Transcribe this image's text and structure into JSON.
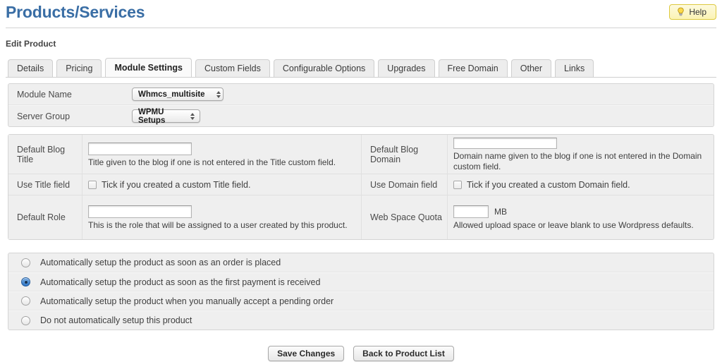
{
  "header": {
    "title": "Products/Services",
    "help_label": "Help",
    "help_icon": "lightbulb-icon",
    "subtitle": "Edit Product",
    "title_color": "#3a6ea5",
    "help_bg": "#fbf3b4",
    "help_border": "#ddc93e"
  },
  "tabs": [
    {
      "label": "Details",
      "active": false
    },
    {
      "label": "Pricing",
      "active": false
    },
    {
      "label": "Module Settings",
      "active": true
    },
    {
      "label": "Custom Fields",
      "active": false
    },
    {
      "label": "Configurable Options",
      "active": false
    },
    {
      "label": "Upgrades",
      "active": false
    },
    {
      "label": "Free Domain",
      "active": false
    },
    {
      "label": "Other",
      "active": false
    },
    {
      "label": "Links",
      "active": false
    }
  ],
  "module_panel": {
    "module_name_label": "Module Name",
    "module_name_value": "Whmcs_multisite",
    "server_group_label": "Server Group",
    "server_group_value": "WPMU Setups"
  },
  "fields": {
    "left": {
      "blog_title_label": "Default Blog Title",
      "blog_title_value": "",
      "blog_title_hint": "Title given to the blog if one is not entered in the Title custom field.",
      "use_title_label": "Use Title field",
      "use_title_checkbox_label": "Tick if you created a custom Title field.",
      "use_title_checked": false,
      "default_role_label": "Default Role",
      "default_role_value": "",
      "default_role_hint": "This is the role that will be assigned to a user created by this product."
    },
    "right": {
      "blog_domain_label": "Default Blog Domain",
      "blog_domain_value": "",
      "blog_domain_hint": "Domain name given to the blog if one is not entered in the Domain custom field.",
      "use_domain_label": "Use Domain field",
      "use_domain_checkbox_label": "Tick if you created a custom Domain field.",
      "use_domain_checked": false,
      "web_space_label": "Web Space Quota",
      "web_space_value": "",
      "web_space_unit": "MB",
      "web_space_hint": "Allowed upload space or leave blank to use Wordpress defaults."
    }
  },
  "autosetup": {
    "options": [
      {
        "label": "Automatically setup the product as soon as an order is placed",
        "selected": false
      },
      {
        "label": "Automatically setup the product as soon as the first payment is received",
        "selected": true
      },
      {
        "label": "Automatically setup the product when you manually accept a pending order",
        "selected": false
      },
      {
        "label": "Do not automatically setup this product",
        "selected": false
      }
    ]
  },
  "footer": {
    "save_label": "Save Changes",
    "back_label": "Back to Product List"
  }
}
